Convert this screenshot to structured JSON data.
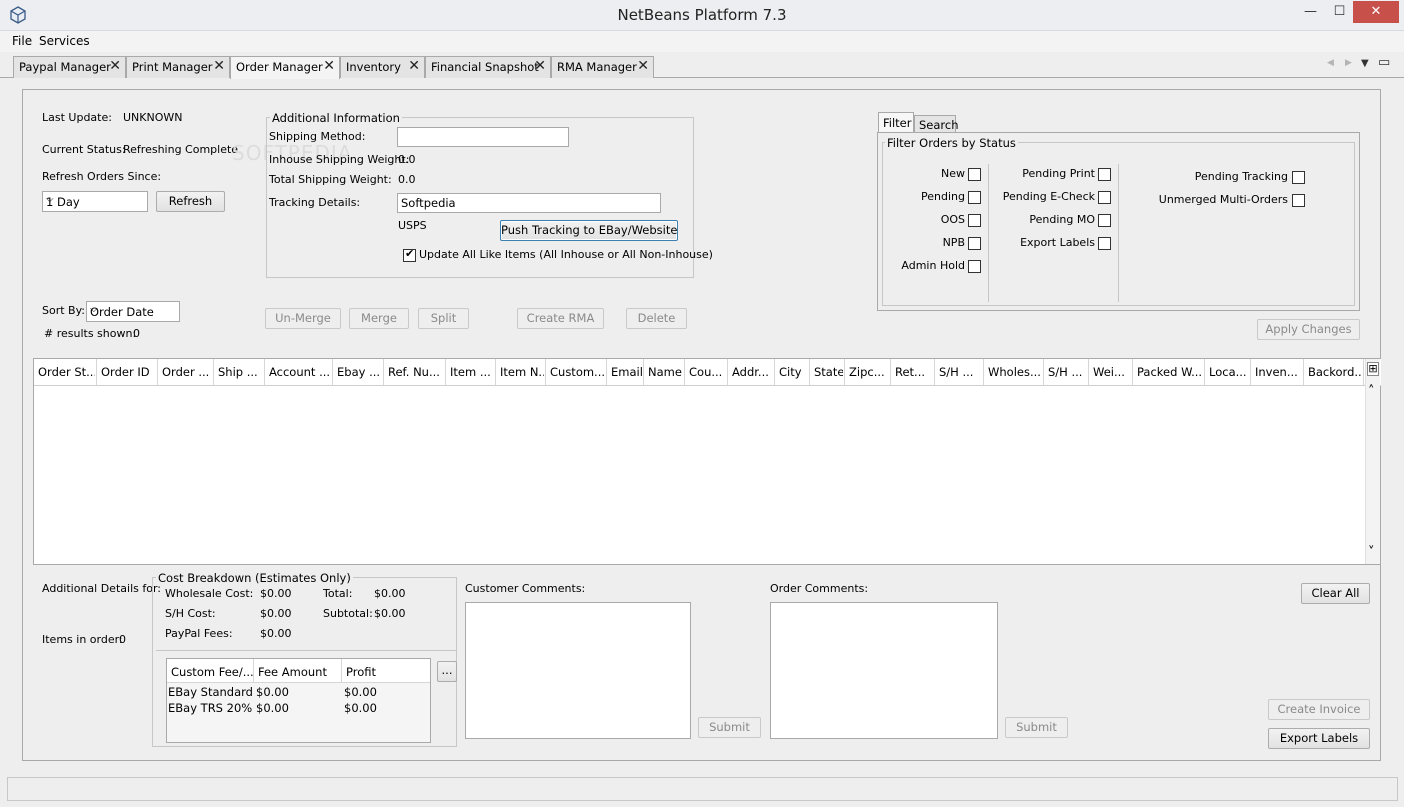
{
  "window": {
    "title": "NetBeans Platform 7.3",
    "min_glyph": "—",
    "max_glyph": "☐",
    "close_glyph": "✕"
  },
  "menu": {
    "items": [
      "File",
      "Services"
    ]
  },
  "tabs": [
    {
      "label": "Paypal Manager"
    },
    {
      "label": "Print Manager"
    },
    {
      "label": "Order Manager"
    },
    {
      "label": "Inventory"
    },
    {
      "label": "Financial Snapshot"
    },
    {
      "label": "RMA Manager"
    }
  ],
  "tab_close_glyph": "✕",
  "status_panel": {
    "last_update_label": "Last Update:",
    "last_update_value": "UNKNOWN",
    "current_status_label": "Current Status:",
    "current_status_value": "Refreshing Complete.",
    "refresh_since_label": "Refresh Orders Since:",
    "refresh_since_value": "1 Day",
    "refresh_button": "Refresh",
    "sort_by_label": "Sort By:",
    "sort_by_value": "Order Date",
    "results_label": "# results shown:",
    "results_value": "0"
  },
  "additional_info": {
    "title": "Additional Information",
    "shipping_method_label": "Shipping Method:",
    "shipping_method_value": "",
    "inhouse_weight_label": "Inhouse Shipping Weight:",
    "inhouse_weight_value": "0.0",
    "total_weight_label": "Total Shipping Weight:",
    "total_weight_value": "0.0",
    "tracking_label": "Tracking Details:",
    "tracking_value": "Softpedia",
    "carrier": "USPS",
    "push_button": "Push Tracking to EBay/Website",
    "update_all_label": "Update All Like Items (All Inhouse or All Non-Inhouse)",
    "update_all_checked": true
  },
  "order_actions": [
    "Un-Merge",
    "Merge",
    "Split",
    "Create RMA",
    "Delete"
  ],
  "filter_panel": {
    "tabs": [
      "Filter",
      "Search"
    ],
    "group_title": "Filter Orders by Status",
    "col1": [
      {
        "label": "New",
        "checked": false
      },
      {
        "label": "Pending",
        "checked": false
      },
      {
        "label": "OOS",
        "checked": false
      },
      {
        "label": "NPB",
        "checked": false
      },
      {
        "label": "Admin Hold",
        "checked": false
      }
    ],
    "col2": [
      {
        "label": "Pending Print",
        "checked": false
      },
      {
        "label": "Pending E-Check",
        "checked": false
      },
      {
        "label": "Pending MO",
        "checked": false
      },
      {
        "label": "Export Labels",
        "checked": false
      }
    ],
    "col3": [
      {
        "label": "Pending Tracking",
        "checked": false
      },
      {
        "label": "Unmerged Multi-Orders",
        "checked": false
      }
    ],
    "apply_button": "Apply Changes"
  },
  "orders_table": {
    "columns": [
      "Order St...",
      "Order ID",
      "Order ...",
      "Ship ...",
      "Account ...",
      "Ebay ...",
      "Ref. Nu...",
      "Item ...",
      "Item N...",
      "Custom...",
      "Email",
      "Name",
      "Cou...",
      "Addr...",
      "City",
      "State",
      "Zipc...",
      "Ret...",
      "S/H ...",
      "Wholes...",
      "S/H ...",
      "Wei...",
      "Packed W...",
      "Loca...",
      "Inven...",
      "Backord..."
    ],
    "rows": [],
    "corner_glyph": "⊞",
    "scroll_up_glyph": "˄",
    "scroll_down_glyph": "˅"
  },
  "details": {
    "additional_details_label": "Additional Details for:",
    "items_in_order_label": "Items in order:",
    "items_in_order_value": "0"
  },
  "cost_breakdown": {
    "title": "Cost Breakdown (Estimates Only)",
    "wholesale_label": "Wholesale Cost:",
    "wholesale_value": "$0.00",
    "sh_label": "S/H Cost:",
    "sh_value": "$0.00",
    "paypal_label": "PayPal Fees:",
    "paypal_value": "$0.00",
    "total_label": "Total:",
    "total_value": "$0.00",
    "subtotal_label": "Subtotal:",
    "subtotal_value": "$0.00",
    "fee_columns": [
      "Custom Fee/...",
      "Fee Amount",
      "Profit"
    ],
    "fee_rows": [
      [
        "EBay Standard",
        "$0.00",
        "$0.00"
      ],
      [
        "EBay TRS 20%",
        "$0.00",
        "$0.00"
      ]
    ],
    "more_button": "..."
  },
  "comments": {
    "customer_label": "Customer Comments:",
    "customer_value": "",
    "order_label": "Order Comments:",
    "order_value": "",
    "submit_label": "Submit"
  },
  "right_actions": {
    "clear_all": "Clear All",
    "create_invoice": "Create Invoice",
    "export_labels": "Export Labels"
  },
  "tab_nav": {
    "left": "◀",
    "right": "▶",
    "menu": "▼",
    "restore": "▭"
  },
  "watermark": "SOFTPEDIA"
}
